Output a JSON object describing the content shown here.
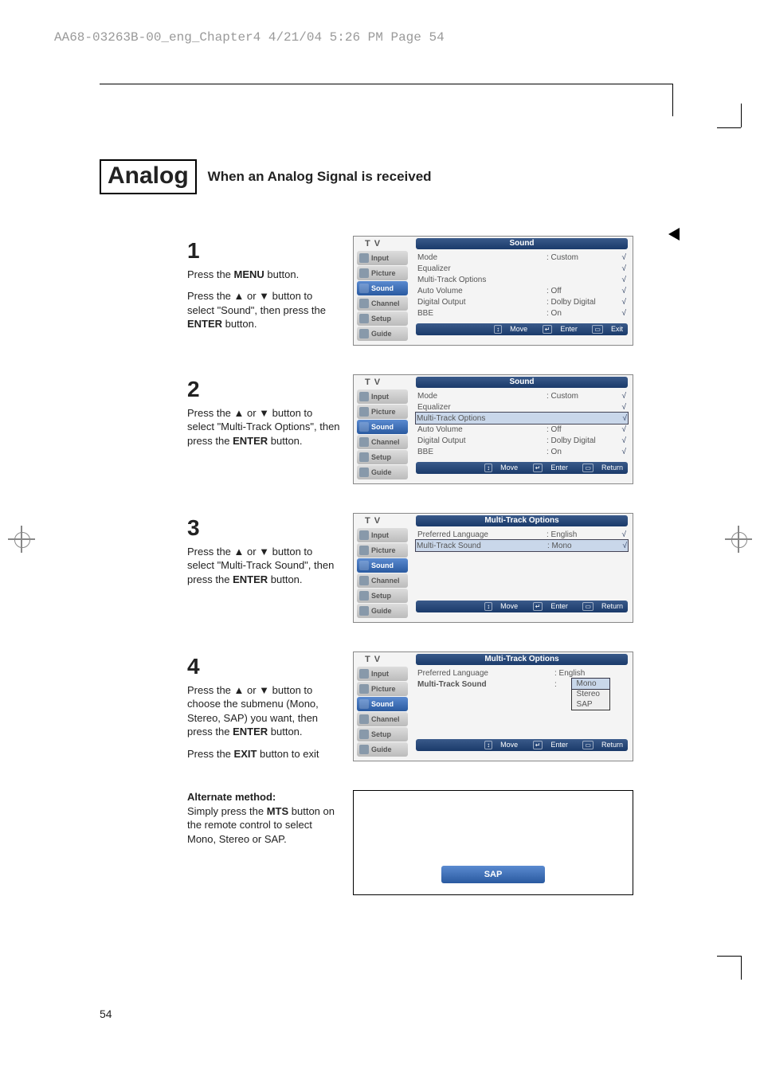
{
  "header_line": "AA68-03263B-00_eng_Chapter4  4/21/04  5:26 PM  Page 54",
  "page_number": "54",
  "analog_badge": "Analog",
  "section_title": "When an Analog Signal is received",
  "steps": {
    "s1": {
      "num": "1",
      "p1a": "Press the ",
      "p1b": "MENU",
      "p1c": " button.",
      "p2a": "Press the ▲ or ▼ button to select \"Sound\", then press the ",
      "p2b": "ENTER",
      "p2c": " button."
    },
    "s2": {
      "num": "2",
      "p1a": "Press the ▲ or ▼ button to select \"Multi-Track Options\", then press the ",
      "p1b": "ENTER",
      "p1c": " button."
    },
    "s3": {
      "num": "3",
      "p1a": "Press the ▲ or ▼ button to select \"Multi-Track Sound\", then press the ",
      "p1b": "ENTER",
      "p1c": " button."
    },
    "s4": {
      "num": "4",
      "p1a": "Press the ▲ or ▼ button to choose the submenu (Mono, Stereo, SAP) you want, then press the ",
      "p1b": "ENTER",
      "p1c": " button.",
      "p2a": "Press the ",
      "p2b": "EXIT",
      "p2c": " button to exit"
    }
  },
  "alt": {
    "hdr": "Alternate method:",
    "p1a": "Simply press the ",
    "p1b": "MTS",
    "p1c": " button on the remote control to select Mono, Stereo or SAP.",
    "pill": "SAP"
  },
  "osd_side": {
    "tv": "T V",
    "input": "Input",
    "picture": "Picture",
    "sound": "Sound",
    "channel": "Channel",
    "setup": "Setup",
    "guide": "Guide"
  },
  "osd": {
    "sound_title": "Sound",
    "mto_title": "Multi-Track Options",
    "mode": "Mode",
    "mode_v": ": Custom",
    "eq": "Equalizer",
    "mto": "Multi-Track Options",
    "auto": "Auto Volume",
    "auto_v": ": Off",
    "dig": "Digital Output",
    "dig_v": ": Dolby Digital",
    "bbe": "BBE",
    "bbe_v": ": On",
    "pref": "Preferred Language",
    "pref_v": ": English",
    "mts": "Multi-Track Sound",
    "mts_v": ": Mono",
    "drop": {
      "mono": "Mono",
      "stereo": "Stereo",
      "sap": "SAP"
    },
    "foot_move": "Move",
    "foot_enter": "Enter",
    "foot_exit": "Exit",
    "foot_return": "Return",
    "arrow": "√",
    "updown": "↕",
    "enter_icon": "↵",
    "menu_icon": "▭"
  }
}
